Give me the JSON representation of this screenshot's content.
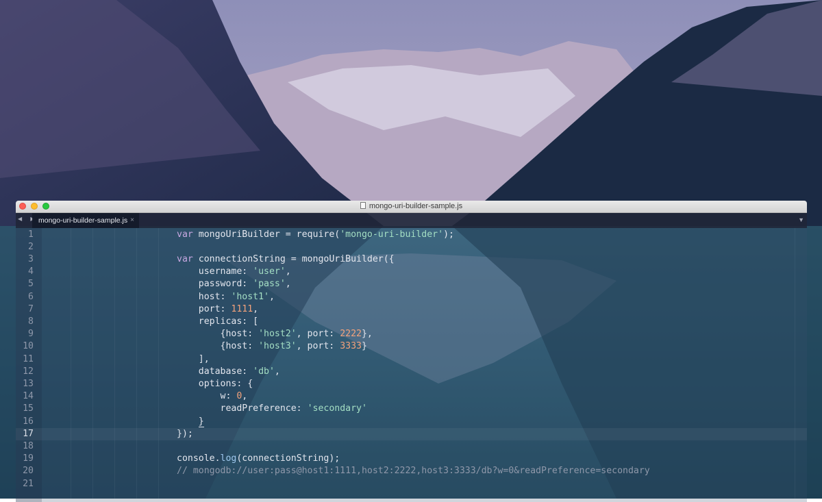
{
  "window": {
    "title": "mongo-uri-builder-sample.js"
  },
  "tabs": [
    {
      "label": "mongo-uri-builder-sample.js",
      "close_label": "×"
    }
  ],
  "icons": {
    "nav": "◀ ▶",
    "tab_menu": "▼"
  },
  "colors": {
    "keyword": "#c8a8e2",
    "string": "#a4dfc4",
    "number": "#f5a37c",
    "comment": "#8f98aa",
    "text": "#e3e6ee"
  },
  "editor": {
    "current_line": 17,
    "lines": [
      {
        "n": "1",
        "t": [
          {
            "k": "kw",
            "v": "var"
          },
          {
            "k": "p",
            "v": " mongoUriBuilder = require("
          },
          {
            "k": "str",
            "v": "'mongo-uri-builder'"
          },
          {
            "k": "p",
            "v": ");"
          }
        ]
      },
      {
        "n": "2",
        "t": []
      },
      {
        "n": "3",
        "t": [
          {
            "k": "kw",
            "v": "var"
          },
          {
            "k": "p",
            "v": " connectionString = mongoUriBuilder({"
          }
        ]
      },
      {
        "n": "4",
        "t": [
          {
            "k": "p",
            "v": "    username: "
          },
          {
            "k": "str",
            "v": "'user'"
          },
          {
            "k": "p",
            "v": ","
          }
        ]
      },
      {
        "n": "5",
        "t": [
          {
            "k": "p",
            "v": "    password: "
          },
          {
            "k": "str",
            "v": "'pass'"
          },
          {
            "k": "p",
            "v": ","
          }
        ]
      },
      {
        "n": "6",
        "t": [
          {
            "k": "p",
            "v": "    host: "
          },
          {
            "k": "str",
            "v": "'host1'"
          },
          {
            "k": "p",
            "v": ","
          }
        ]
      },
      {
        "n": "7",
        "t": [
          {
            "k": "p",
            "v": "    port: "
          },
          {
            "k": "num",
            "v": "1111"
          },
          {
            "k": "p",
            "v": ","
          }
        ]
      },
      {
        "n": "8",
        "t": [
          {
            "k": "p",
            "v": "    replicas: ["
          }
        ]
      },
      {
        "n": "9",
        "t": [
          {
            "k": "p",
            "v": "        {host: "
          },
          {
            "k": "str",
            "v": "'host2'"
          },
          {
            "k": "p",
            "v": ", port: "
          },
          {
            "k": "num",
            "v": "2222"
          },
          {
            "k": "p",
            "v": "},"
          }
        ]
      },
      {
        "n": "10",
        "t": [
          {
            "k": "p",
            "v": "        {host: "
          },
          {
            "k": "str",
            "v": "'host3'"
          },
          {
            "k": "p",
            "v": ", port: "
          },
          {
            "k": "num",
            "v": "3333"
          },
          {
            "k": "p",
            "v": "}"
          }
        ]
      },
      {
        "n": "11",
        "t": [
          {
            "k": "p",
            "v": "    ],"
          }
        ]
      },
      {
        "n": "12",
        "t": [
          {
            "k": "p",
            "v": "    database: "
          },
          {
            "k": "str",
            "v": "'db'"
          },
          {
            "k": "p",
            "v": ","
          }
        ]
      },
      {
        "n": "13",
        "t": [
          {
            "k": "p",
            "v": "    options: {"
          }
        ]
      },
      {
        "n": "14",
        "t": [
          {
            "k": "p",
            "v": "        w: "
          },
          {
            "k": "num",
            "v": "0"
          },
          {
            "k": "p",
            "v": ","
          }
        ]
      },
      {
        "n": "15",
        "t": [
          {
            "k": "p",
            "v": "        readPreference: "
          },
          {
            "k": "str",
            "v": "'secondary'"
          }
        ]
      },
      {
        "n": "16",
        "t": [
          {
            "k": "p",
            "v": "    "
          },
          {
            "k": "bracket",
            "v": "}"
          }
        ]
      },
      {
        "n": "17",
        "t": [
          {
            "k": "p",
            "v": "});"
          }
        ]
      },
      {
        "n": "18",
        "t": []
      },
      {
        "n": "19",
        "t": [
          {
            "k": "p",
            "v": "console."
          },
          {
            "k": "fn",
            "v": "log"
          },
          {
            "k": "p",
            "v": "(connectionString);"
          }
        ]
      },
      {
        "n": "20",
        "t": [
          {
            "k": "cm",
            "v": "// mongodb://user:pass@host1:1111,host2:2222,host3:3333/db?w=0&readPreference=secondary"
          }
        ]
      },
      {
        "n": "21",
        "t": []
      }
    ]
  }
}
